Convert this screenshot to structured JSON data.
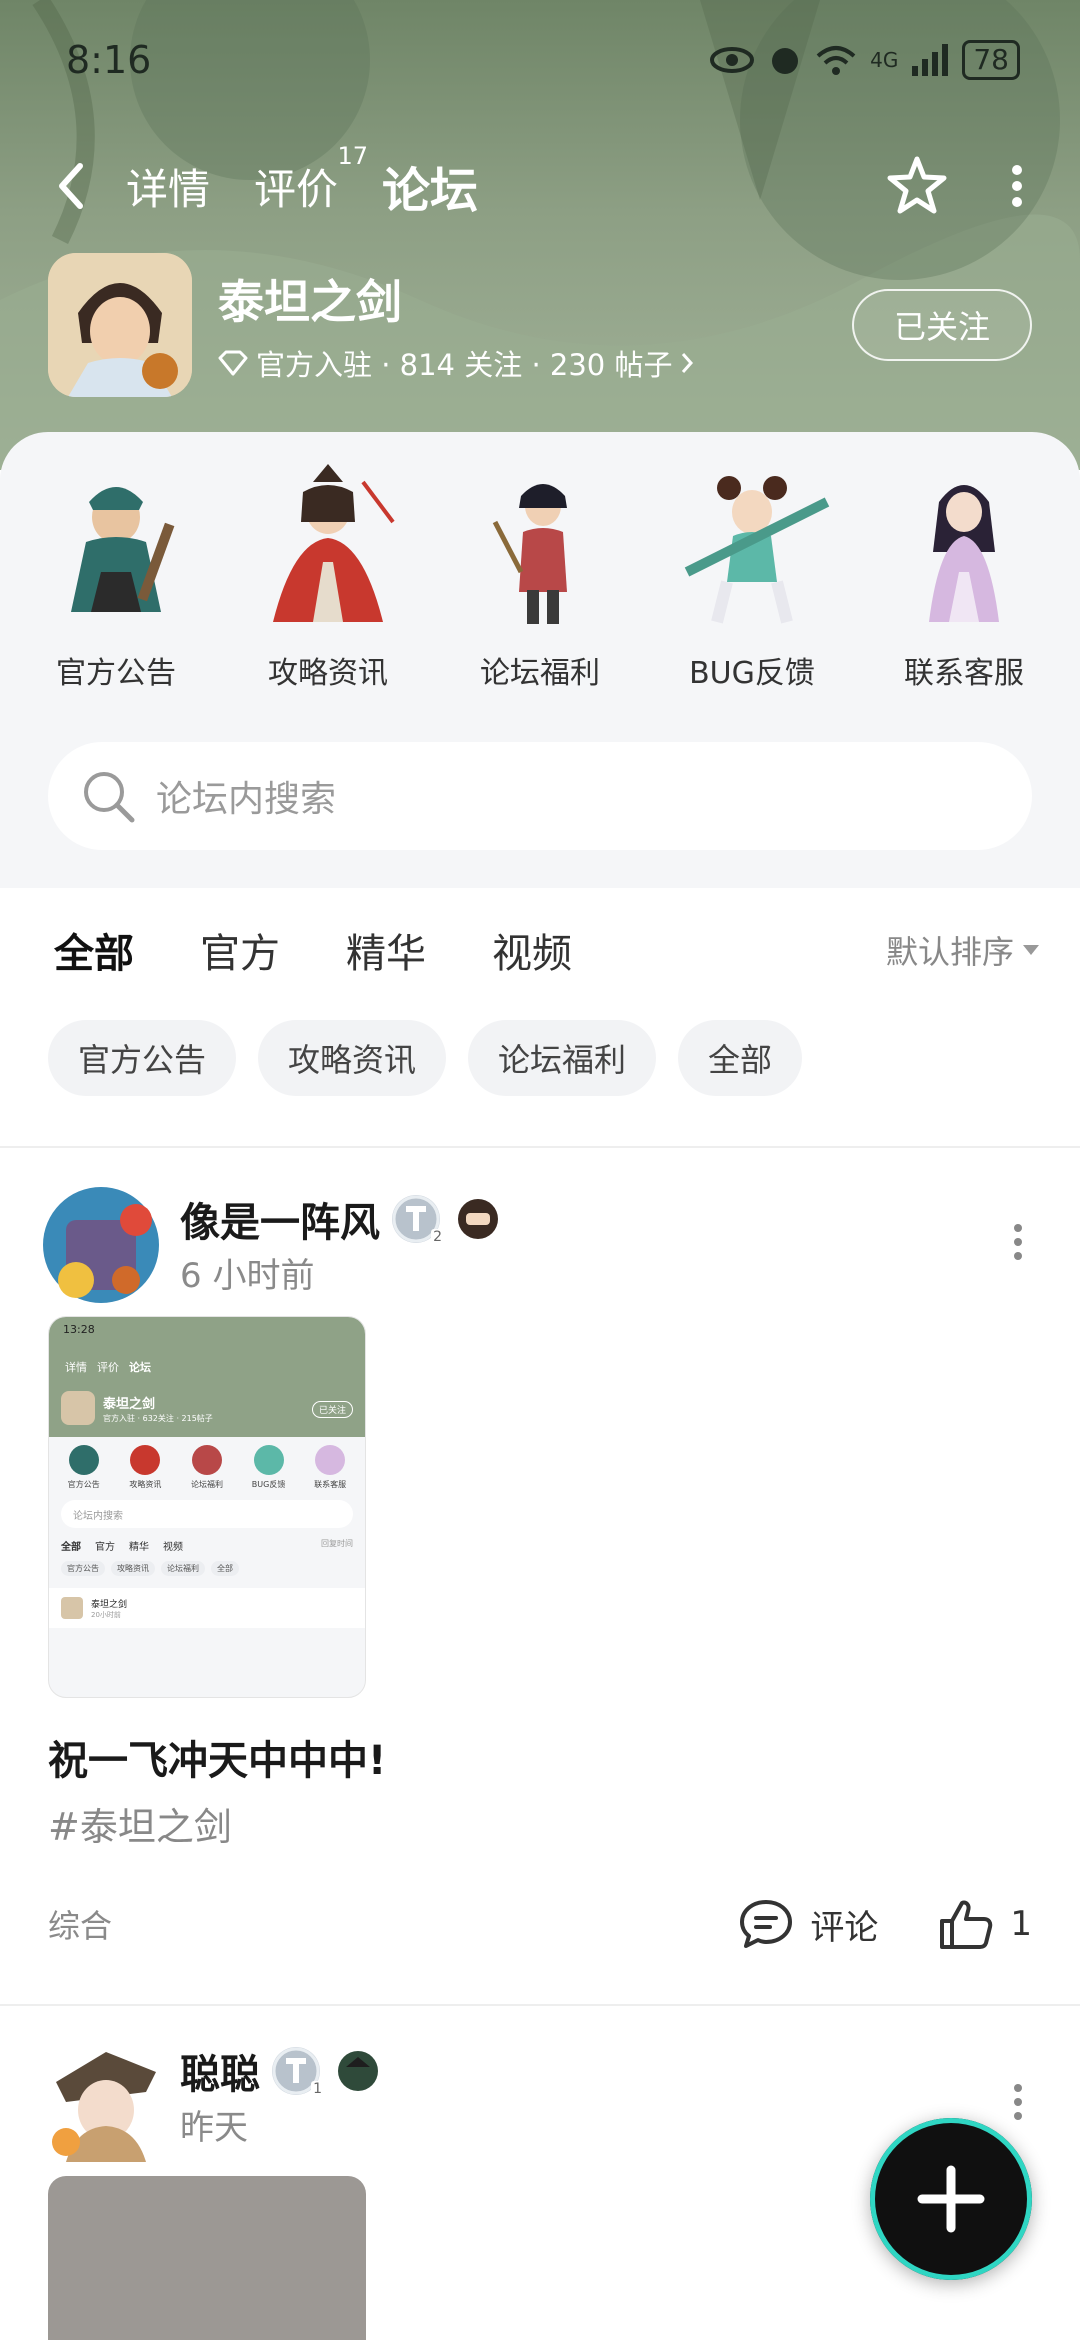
{
  "status_bar": {
    "time": "8:16",
    "network": "4G",
    "battery": "78"
  },
  "nav": {
    "tabs": [
      {
        "label": "详情"
      },
      {
        "label": "评价",
        "count": "17"
      },
      {
        "label": "论坛"
      }
    ]
  },
  "game": {
    "name": "泰坦之剑",
    "meta": "官方入驻 · 814 关注 · 230 帖子",
    "follow_label": "已关注"
  },
  "categories": [
    {
      "label": "官方公告"
    },
    {
      "label": "攻略资讯"
    },
    {
      "label": "论坛福利"
    },
    {
      "label": "BUG反馈"
    },
    {
      "label": "联系客服"
    }
  ],
  "search": {
    "placeholder": "论坛内搜索"
  },
  "feed_tabs": [
    {
      "label": "全部"
    },
    {
      "label": "官方"
    },
    {
      "label": "精华"
    },
    {
      "label": "视频"
    }
  ],
  "sort_label": "默认排序",
  "chips": [
    {
      "label": "官方公告"
    },
    {
      "label": "攻略资讯"
    },
    {
      "label": "论坛福利"
    },
    {
      "label": "全部"
    }
  ],
  "posts": [
    {
      "username": "像是一阵风",
      "level_badge": "2",
      "time": "6 小时前",
      "title": "祝一飞冲天中中中!",
      "tag": "#泰坦之剑",
      "category": "综合",
      "comment_label": "评论",
      "like_count": "1",
      "thumbnail": {
        "time": "13:28",
        "tabs": [
          "详情",
          "评价",
          "论坛"
        ],
        "game_name": "泰坦之剑",
        "meta": "官方入驻 · 632关注 · 215帖子",
        "follow": "已关注",
        "cats": [
          "官方公告",
          "攻略资讯",
          "论坛福利",
          "BUG反馈",
          "联系客服"
        ],
        "search": "论坛内搜索",
        "feed_tabs": [
          "全部",
          "官方",
          "精华",
          "视频"
        ],
        "sort": "回复时间",
        "chips": [
          "官方公告",
          "攻略资讯",
          "论坛福利",
          "全部"
        ],
        "post_user": "泰坦之剑",
        "post_time": "20小时前"
      }
    },
    {
      "username": "聪聪",
      "level_badge": "1",
      "time": "昨天"
    }
  ],
  "colors": {
    "accent": "#2ed6c0",
    "header_bg": "#7f937a",
    "fab_bg": "#101010"
  }
}
